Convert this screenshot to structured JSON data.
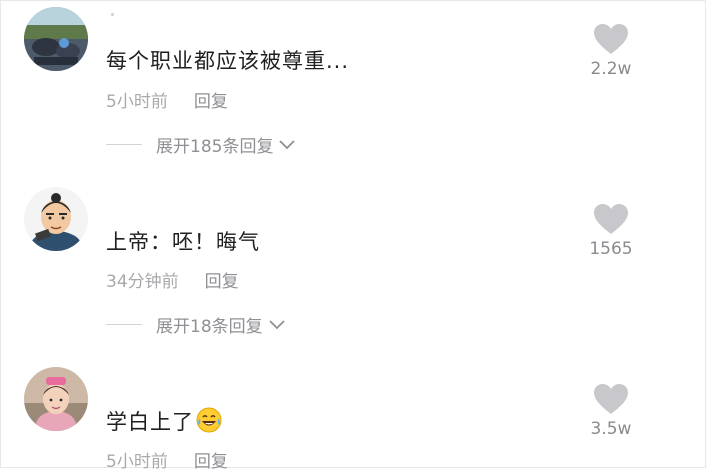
{
  "comments": [
    {
      "text": "每个职业都应该被尊重...",
      "time": "5小时前",
      "reply_label": "回复",
      "expand_label": "展开185条回复",
      "likes": "2.2w"
    },
    {
      "text": "上帝：呸！晦气",
      "time": "34分钟前",
      "reply_label": "回复",
      "expand_label": "展开18条回复",
      "likes": "1565"
    },
    {
      "text": "学白上了",
      "text_emoji": "laughing-tears-emoji",
      "time": "5小时前",
      "reply_label": "回复",
      "likes": "3.5w"
    }
  ],
  "colors": {
    "text": "#1f1f1f",
    "meta": "#a9a9ad",
    "heart": "#c7c7cc",
    "divider": "#d4d4d8"
  }
}
